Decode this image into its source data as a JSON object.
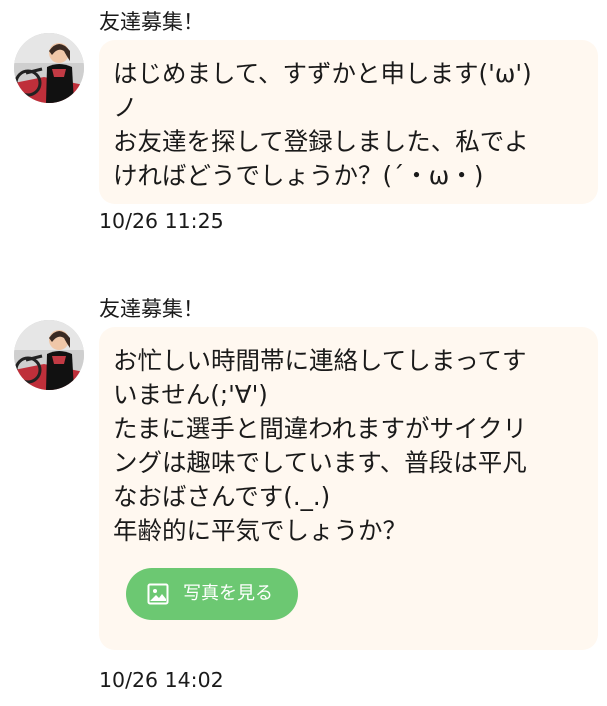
{
  "messages": [
    {
      "sender": "友達募集！",
      "text": "はじめまして、すずかと申します('ω')\nノ\nお友達を探して登録しました、私でよ\nければどうでしょうか？(´・ω・)",
      "time": "10/26 11:25",
      "avatar_icon": "user-avatar-photo"
    },
    {
      "sender": "友達募集！",
      "text": "お忙しい時間帯に連絡してしまってす\nいません(;'∀')\nたまに選手と間違われますがサイクリ\nングは趣味でしています、普段は平凡\nなおばさんです(._.)\n年齢的に平気でしょうか？",
      "photo_button_label": "写真を見る",
      "photo_button_icon": "image-icon",
      "time": "10/26 14:02",
      "avatar_icon": "user-avatar-photo"
    }
  ],
  "colors": {
    "bubble_background": "#fff8f0",
    "photo_button_background": "#6cc872",
    "photo_button_text": "#ffffff",
    "text": "#1a1a1a"
  }
}
